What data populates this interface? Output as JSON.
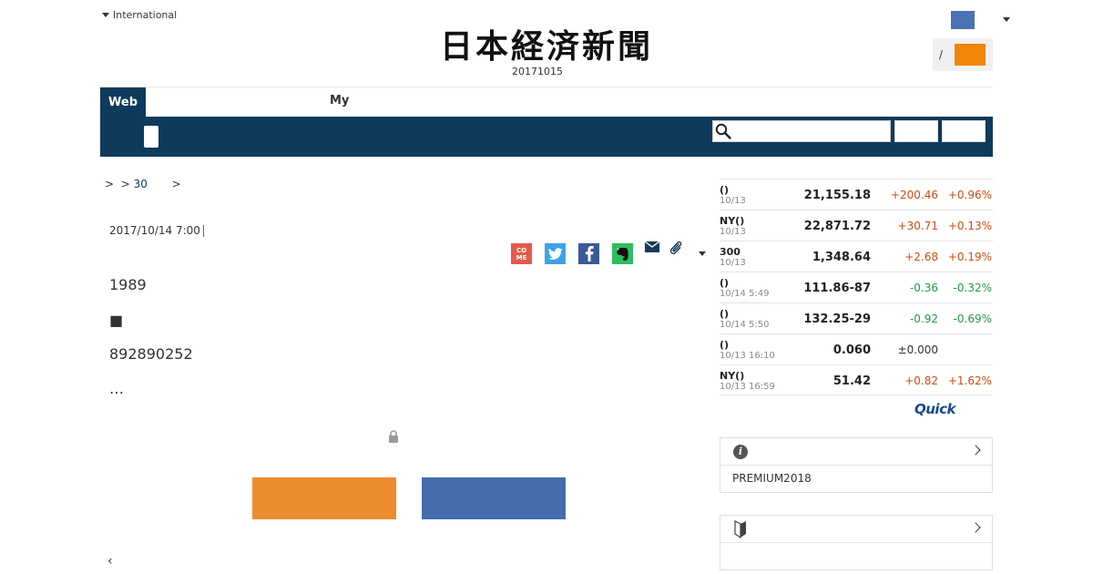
{
  "header": {
    "international_label": "International",
    "logo_text": "日本経済新聞",
    "date": "20171015",
    "paper_slash": "/"
  },
  "nav": {
    "tab_web": "Web",
    "tab_my": "My"
  },
  "breadcrumb": {
    "sep1": ">",
    "sep2": ">",
    "link": "30",
    "sep3": ">"
  },
  "article": {
    "date": "2017/10/14 7:00",
    "paragraphs": [
      "1989",
      "■",
      "892890252",
      "…"
    ]
  },
  "share": {
    "come_label": "CO\nME"
  },
  "market": {
    "rows": [
      {
        "name": "()",
        "time": "10/13",
        "value": "21,155.18",
        "change": "+200.46",
        "pct": "+0.96%"
      },
      {
        "name": "NY()",
        "time": "10/13",
        "value": "22,871.72",
        "change": "+30.71",
        "pct": "+0.13%"
      },
      {
        "name": "300",
        "time": "10/13",
        "value": "1,348.64",
        "change": "+2.68",
        "pct": "+0.19%"
      },
      {
        "name": "()",
        "time": "10/14 5:49",
        "value": "111.86-87",
        "change": "-0.36",
        "pct": "-0.32%"
      },
      {
        "name": "()",
        "time": "10/14 5:50",
        "value": "132.25-29",
        "change": "-0.92",
        "pct": "-0.69%"
      },
      {
        "name": "()",
        "time": "10/13 16:10",
        "value": "0.060",
        "change": "±0.000",
        "pct": ""
      },
      {
        "name": "NY()",
        "time": "10/13 16:59",
        "value": "51.42",
        "change": "+0.82",
        "pct": "+1.62%"
      }
    ],
    "source_logo": "Quick",
    "colors": {
      "up": "#d24a13",
      "down": "#229944"
    }
  },
  "sidebar": {
    "box1_text": "PREMIUM2018"
  },
  "colors": {
    "navy": "#0e3a5c",
    "orange_button": "#ed8c2f",
    "blue_button": "#466dae"
  }
}
